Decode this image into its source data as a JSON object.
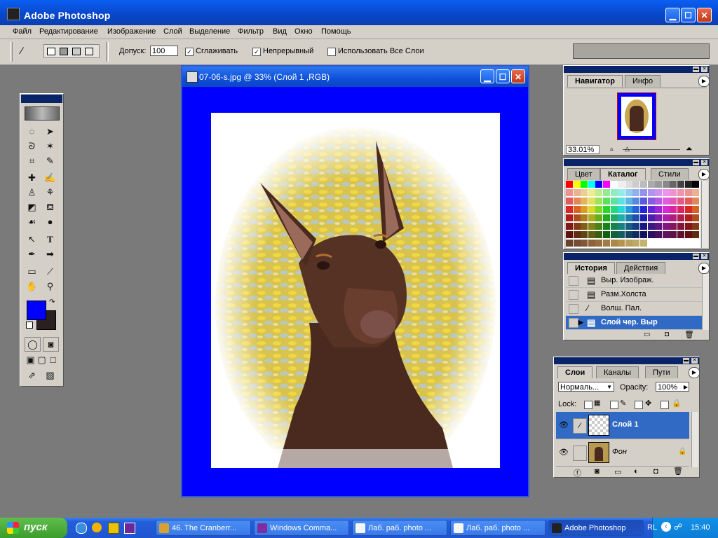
{
  "app": {
    "title": "Adobe Photoshop"
  },
  "menu": [
    "Файл",
    "Редактирование",
    "Изображение",
    "Слой",
    "Выделение",
    "Фильтр",
    "Вид",
    "Окно",
    "Помощь"
  ],
  "options": {
    "tolerance_label": "Допуск:",
    "tolerance_value": "100",
    "anti_alias_label": "Сглаживать",
    "anti_alias_checked": "✓",
    "contiguous_label": "Непрерывный",
    "contiguous_checked": "✓",
    "all_layers_label": "Использовать Все Слои"
  },
  "document": {
    "title": "07-06-s.jpg @ 33% (Слой 1 ,RGB)"
  },
  "navigator": {
    "tabs": [
      "Навигатор",
      "Инфо"
    ],
    "zoom": "33.01%"
  },
  "swatches": {
    "tabs": [
      "Цвет",
      "Каталог",
      "Стили"
    ]
  },
  "history": {
    "tabs": [
      "История",
      "Действия"
    ],
    "items": [
      "Выр. Изображ.",
      "Разм.Холста",
      "Волш. Пал.",
      "Слой чер. Выр"
    ]
  },
  "layers": {
    "tabs": [
      "Слои",
      "Каналы",
      "Пути"
    ],
    "blend_mode": "Нормаль...",
    "opacity_label": "Opacity:",
    "opacity_value": "100%",
    "lock_label": "Lock:",
    "items": [
      {
        "name": "Слой 1"
      },
      {
        "name": "Фон"
      }
    ]
  },
  "taskbar": {
    "start": "пуск",
    "items": [
      "46. The Cranberr...",
      "Windows Comma...",
      "Лаб. раб. photo ...",
      "Лаб. раб. photo ...",
      "Adobe Photoshop"
    ],
    "lang": "RL",
    "time": "15:40"
  },
  "colors": {
    "foreground": "#0000ff",
    "background": "#2a2020",
    "canvas_bg": "#0000ff",
    "selection": "#316ac5"
  }
}
